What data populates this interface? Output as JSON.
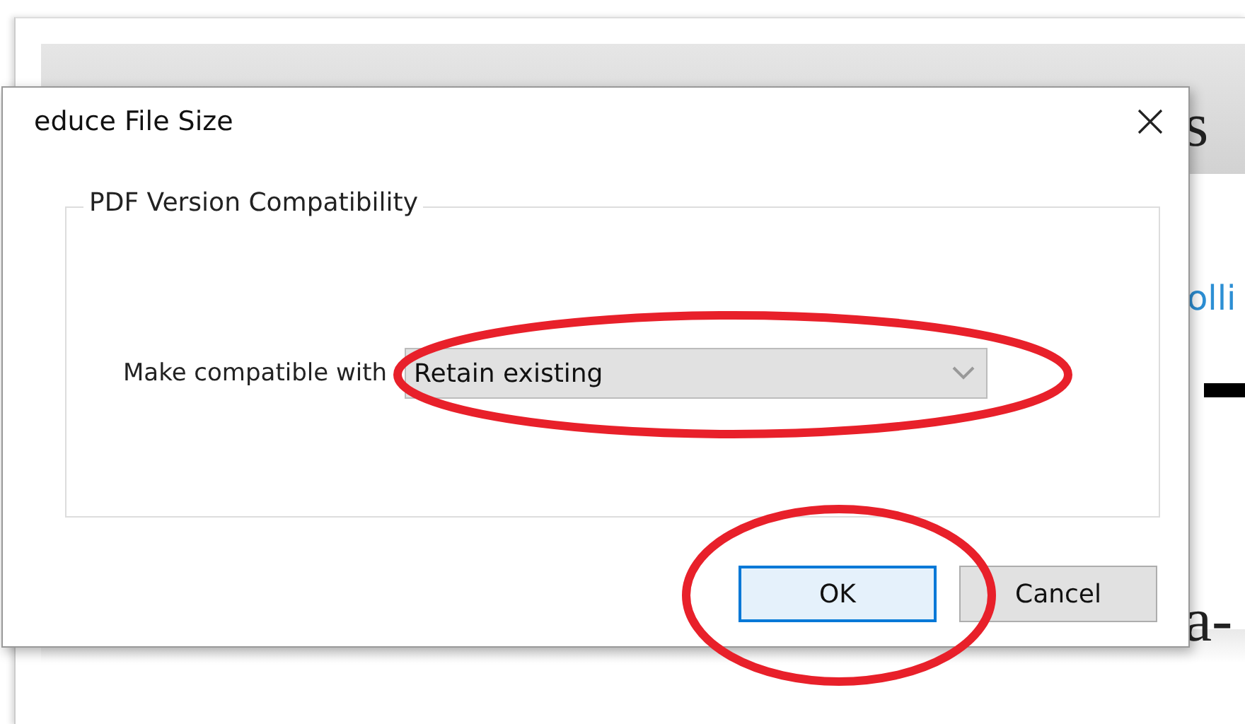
{
  "document": {
    "fragments": [
      {
        "kind": "heading",
        "text": "s"
      },
      {
        "kind": "link",
        "text": "olli"
      },
      {
        "kind": "body",
        "text": "a-"
      }
    ]
  },
  "dialog": {
    "title": "educe File Size",
    "group": {
      "legend": "PDF Version Compatibility",
      "label": "Make compatible with",
      "dropdown": {
        "value": "Retain existing",
        "circled": true
      }
    },
    "buttons": [
      {
        "label": "OK",
        "default": true,
        "circled": true
      },
      {
        "label": "Cancel",
        "default": false,
        "circled": false
      }
    ]
  }
}
